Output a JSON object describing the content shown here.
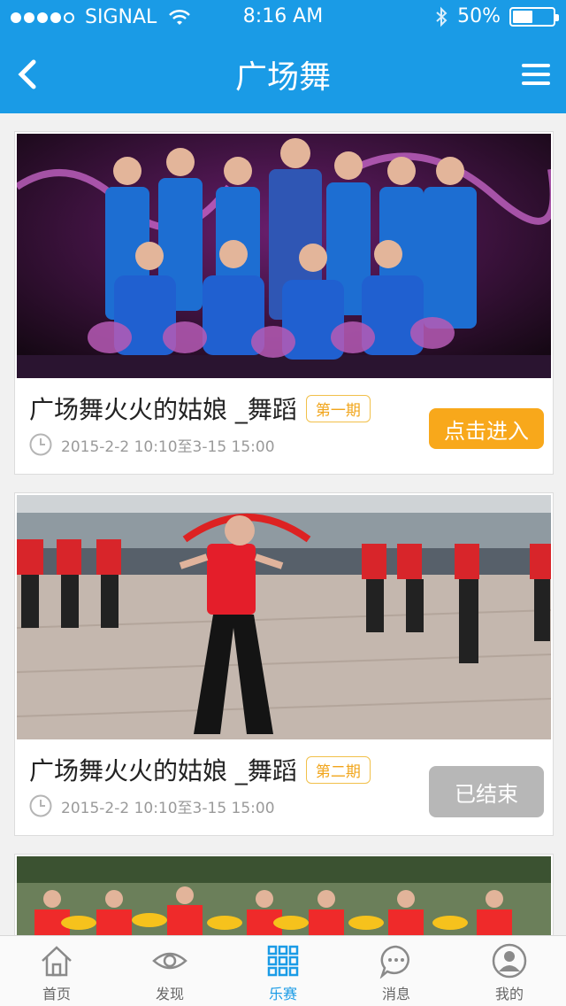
{
  "status_bar": {
    "carrier": "SIGNAL",
    "time": "8:16 AM",
    "battery": "50%",
    "battery_level": 0.5
  },
  "nav": {
    "title": "广场舞"
  },
  "cards": [
    {
      "title": "广场舞火火的姑娘 _舞蹈",
      "issue": "第一期",
      "time": "2015-2-2 10:10至3-15 15:00",
      "button": "点击进入",
      "button_color": "#f8a81b"
    },
    {
      "title": "广场舞火火的姑娘 _舞蹈",
      "issue": "第二期",
      "time": "2015-2-2 10:10至3-15 15:00",
      "button": "已结束",
      "button_color": "#b7b7b7"
    }
  ],
  "tabbar": {
    "items": [
      {
        "label": "首页",
        "icon": "home-icon",
        "active": false
      },
      {
        "label": "发现",
        "icon": "eye-icon",
        "active": false
      },
      {
        "label": "乐赛",
        "icon": "grid-icon",
        "active": true
      },
      {
        "label": "消息",
        "icon": "chat-icon",
        "active": false
      },
      {
        "label": "我的",
        "icon": "user-icon",
        "active": false
      }
    ]
  },
  "colors": {
    "brand": "#1a9be6",
    "accent": "#f8a81b",
    "disabled": "#b7b7b7"
  }
}
